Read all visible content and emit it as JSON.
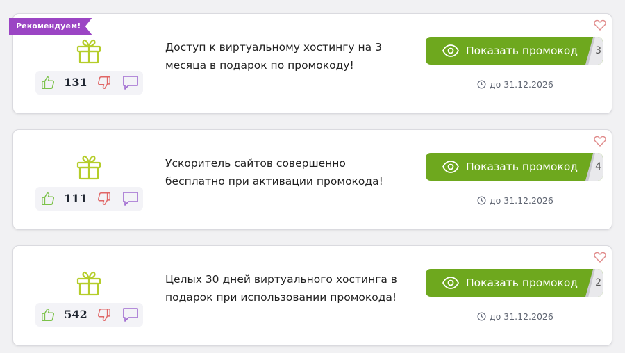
{
  "coupons": [
    {
      "badge": "Рекомендуем!",
      "votes": "131",
      "description": "Доступ к виртуальному хостингу на 3 месяца в подарок по промокоду!",
      "button_label": "Показать промокод",
      "code_peek": "3",
      "expiry": "до 31.12.2026"
    },
    {
      "badge": "",
      "votes": "111",
      "description": "Ускоритель сайтов совершенно бесплатно при активации промокода!",
      "button_label": "Показать промокод",
      "code_peek": "4",
      "expiry": "до 31.12.2026"
    },
    {
      "badge": "",
      "votes": "542",
      "description": "Целых 30 дней виртуального хостинга в подарок при использовании промокода!",
      "button_label": "Показать промокод",
      "code_peek": "2",
      "expiry": "до 31.12.2026"
    }
  ],
  "colors": {
    "accent_green": "#6ea81e",
    "badge_purple": "#9b45c4",
    "gift_icon": "#b5cd2a",
    "thumb_up": "#7cc24a",
    "thumb_down": "#e06666",
    "comment_icon": "#a06ad0",
    "heart": "#e08a8a"
  },
  "icons": [
    "gift-icon",
    "thumbs-up-icon",
    "thumbs-down-icon",
    "comment-icon",
    "eye-icon",
    "clock-icon",
    "heart-icon"
  ]
}
